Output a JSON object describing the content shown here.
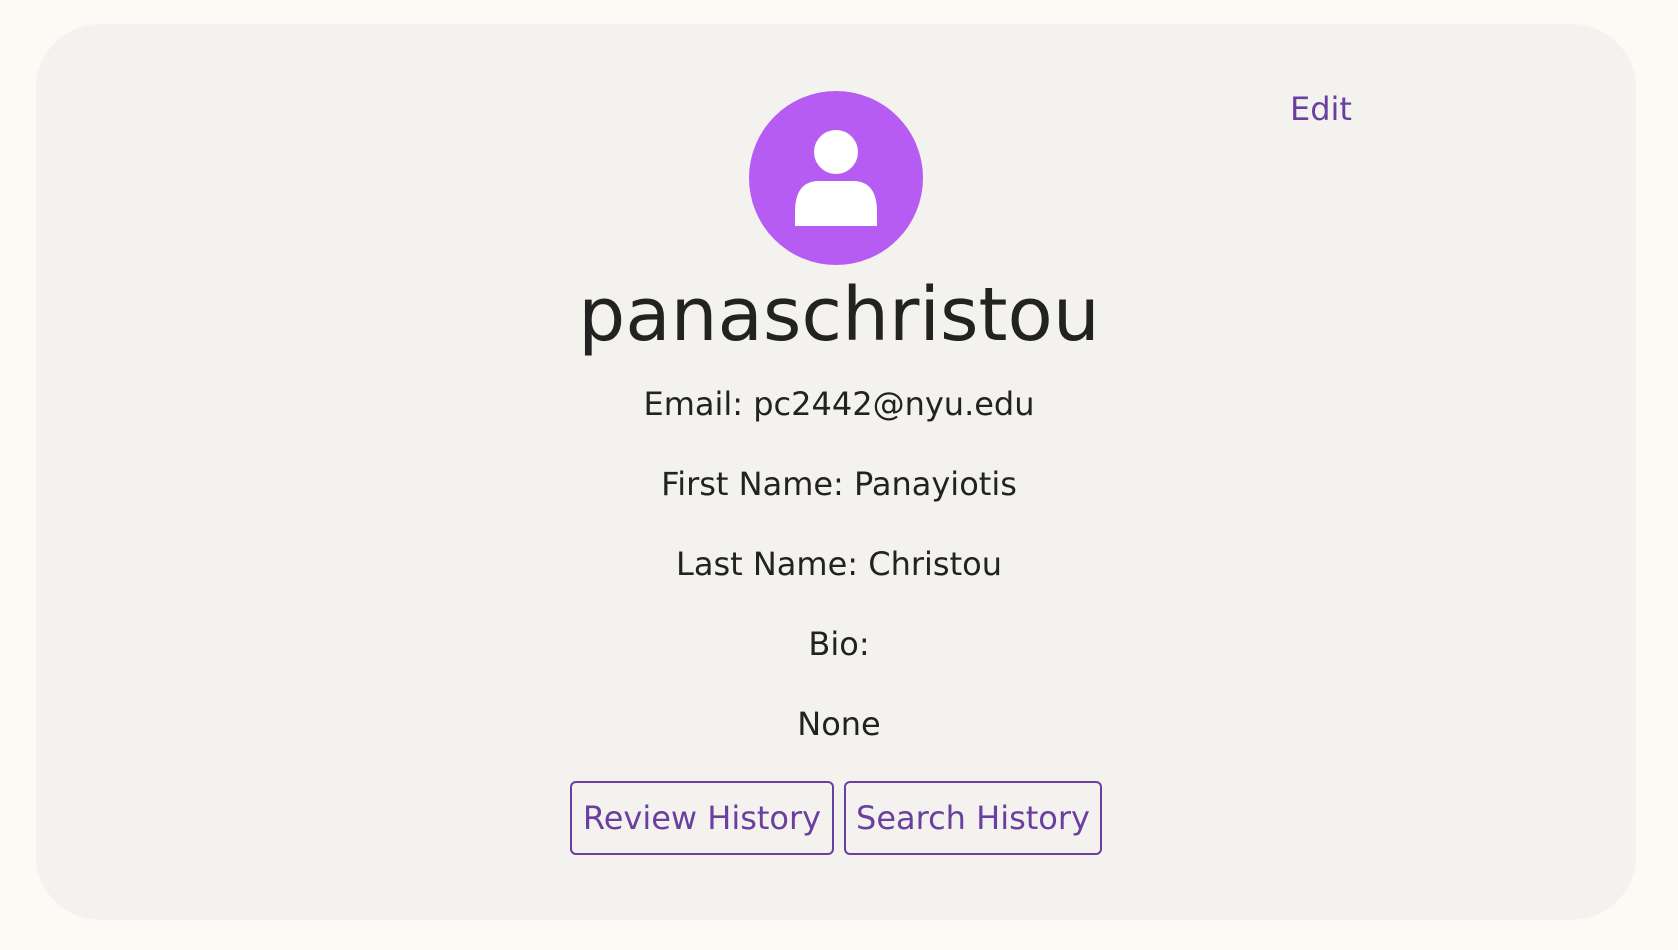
{
  "profile": {
    "edit_label": "Edit",
    "username": "panaschristou",
    "email_line": "Email: pc2442@nyu.edu",
    "first_name_line": "First Name: Panayiotis",
    "last_name_line": "Last Name: Christou",
    "bio_label": "Bio:",
    "bio_value": "None"
  },
  "actions": {
    "review_history_label": "Review History",
    "search_history_label": "Search History"
  },
  "icons": {
    "avatar": "user-icon"
  },
  "colors": {
    "accent": "#6b3fa0",
    "avatar_bg": "#b65cf3",
    "card_bg": "#f3f2ee",
    "page_bg": "#fcfaf5"
  }
}
